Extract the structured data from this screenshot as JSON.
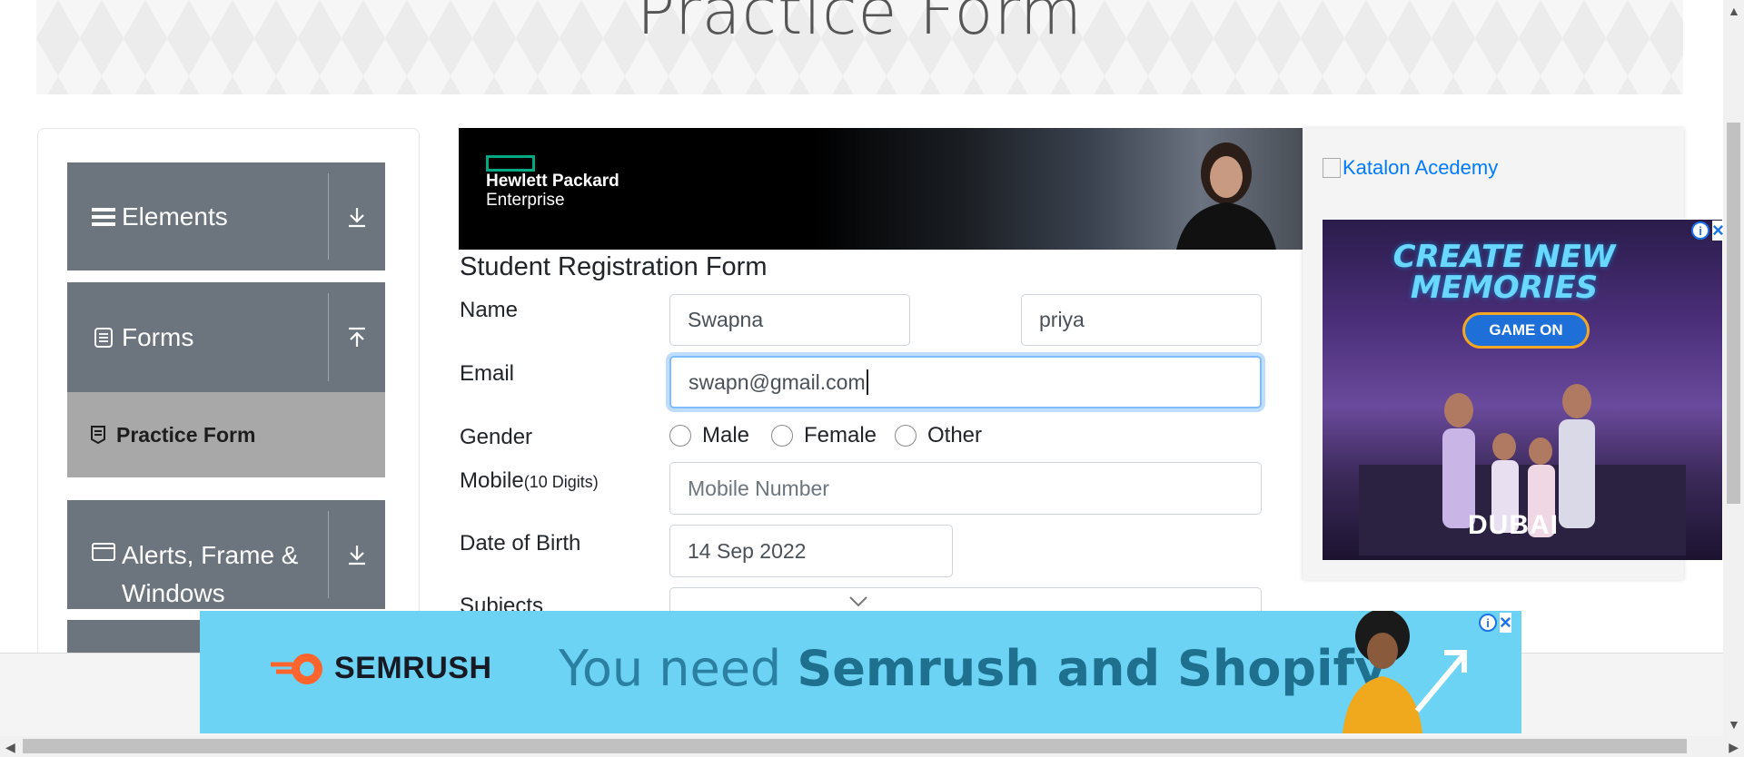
{
  "header": {
    "title": "Practice Form"
  },
  "sidebar": {
    "groups": [
      {
        "label": "Elements",
        "icon": "hamburger-icon",
        "state": "collapsed"
      },
      {
        "label": "Forms",
        "icon": "document-icon",
        "state": "expanded"
      },
      {
        "label": "Alerts, Frame &",
        "label2": "Windows",
        "icon": "window-icon",
        "state": "collapsed"
      }
    ],
    "active_item": {
      "label": "Practice Form",
      "icon": "form-icon"
    }
  },
  "top_ad": {
    "brand_line1": "Hewlett Packard",
    "brand_line2": "Enterprise",
    "accent": "#01a982"
  },
  "form": {
    "title": "Student Registration Form",
    "name_label": "Name",
    "first_name_value": "Swapna",
    "last_name_value": "priya",
    "email_label": "Email",
    "email_value": "swapn@gmail.com",
    "gender_label": "Gender",
    "gender_options": [
      "Male",
      "Female",
      "Other"
    ],
    "mobile_label": "Mobile",
    "mobile_hint": "(10 Digits)",
    "mobile_placeholder": "Mobile Number",
    "dob_label": "Date of Birth",
    "dob_value": "14 Sep 2022",
    "subjects_label": "Subjects"
  },
  "right_ad": {
    "link_text": "Katalon Acedemy",
    "headline_line1": "CREATE NEW",
    "headline_line2": "MEMORIES",
    "button_label": "GAME ON",
    "logo_text": "DUBAI"
  },
  "bottom_ad": {
    "brand": "SEMRUSH",
    "text_prefix": "You need ",
    "text_bold": "Semrush and Shopify",
    "accent": "#ff642d",
    "background": "#6cd3f5"
  },
  "colors": {
    "sidebar_group": "#6c757d",
    "active_item": "#a8a8a8",
    "link": "#007bff",
    "focus": "#80bdff"
  }
}
